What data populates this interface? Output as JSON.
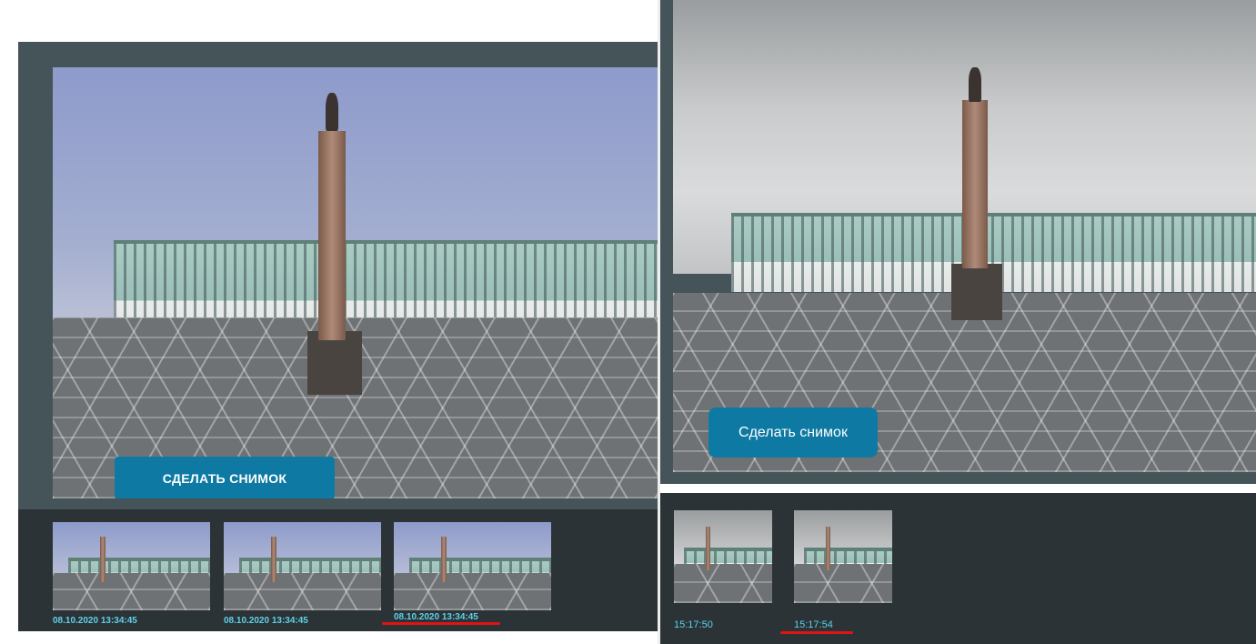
{
  "left": {
    "snapshot_button": "СДЕЛАТЬ СНИМОК",
    "thumbnails": [
      {
        "caption": "08.10.2020 13:34:45"
      },
      {
        "caption": "08.10.2020 13:34:45"
      },
      {
        "caption": "08.10.2020 13:34:45",
        "underlined": true
      }
    ]
  },
  "right": {
    "snapshot_button": "Сделать снимок",
    "thumbnails": [
      {
        "caption": "15:17:50"
      },
      {
        "caption": "15:17:54",
        "underlined": true
      }
    ]
  },
  "colors": {
    "panel_bg": "#455459",
    "strip_bg": "#2b3336",
    "button_bg": "#0e7aa3",
    "caption_text": "#5fd1e8",
    "underline": "#e01414"
  },
  "icons": [
    "webcam-view-palace-square"
  ]
}
